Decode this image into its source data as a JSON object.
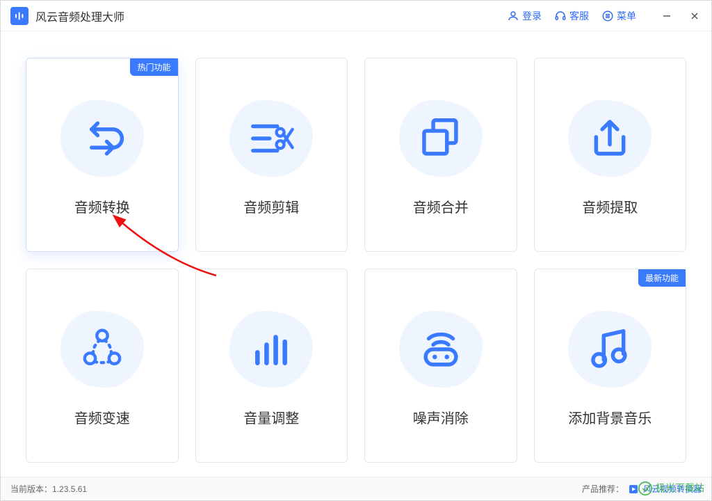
{
  "app": {
    "title": "风云音频处理大师"
  },
  "titlebar": {
    "login": "登录",
    "support": "客服",
    "menu": "菜单"
  },
  "cards": [
    {
      "title": "音频转换",
      "badge": "热门功能",
      "icon": "convert"
    },
    {
      "title": "音频剪辑",
      "badge": null,
      "icon": "cut"
    },
    {
      "title": "音频合并",
      "badge": null,
      "icon": "merge"
    },
    {
      "title": "音频提取",
      "badge": null,
      "icon": "extract"
    },
    {
      "title": "音频变速",
      "badge": null,
      "icon": "speed"
    },
    {
      "title": "音量调整",
      "badge": null,
      "icon": "volume"
    },
    {
      "title": "噪声消除",
      "badge": null,
      "icon": "denoise"
    },
    {
      "title": "添加背景音乐",
      "badge": "最新功能",
      "icon": "bgm"
    }
  ],
  "footer": {
    "version_label": "当前版本：",
    "version": "1.23.5.61",
    "recommend_label": "产品推荐：",
    "recommend_name": "风云视频转换器"
  },
  "watermark": "极光下载站",
  "colors": {
    "accent": "#3a7afe"
  }
}
